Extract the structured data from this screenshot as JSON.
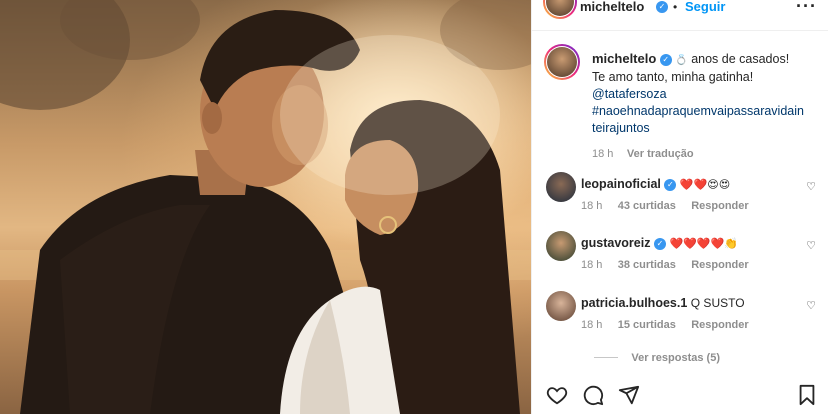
{
  "header": {
    "username": "micheltelo",
    "separator": "•",
    "follow_label": "Seguir",
    "more_icon": "more-horizontal-icon"
  },
  "caption": {
    "username": "micheltelo",
    "line1_text": "anos de casados!",
    "line2": "Te amo tanto, minha gatinha!",
    "mention": "@tatafersoza",
    "hashtag_line1": "#naoehnadapraquemvaipassaravidain",
    "hashtag_line2": "teirajuntos",
    "time": "18 h",
    "translate_label": "Ver tradução"
  },
  "comments": [
    {
      "username": "leopainoficial",
      "text": "❤️❤️😍😍",
      "time": "18 h",
      "likes": "43 curtidas",
      "reply_label": "Responder"
    },
    {
      "username": "gustavoreiz",
      "text": "❤️❤️❤️❤️👏",
      "time": "18 h",
      "likes": "38 curtidas",
      "reply_label": "Responder"
    },
    {
      "username": "patricia.bulhoes.1",
      "text": "Q SUSTO",
      "time": "18 h",
      "likes": "15 curtidas",
      "reply_label": "Responder"
    }
  ],
  "view_replies_label": "Ver respostas (5)",
  "actions": {
    "like_icon": "heart-icon",
    "comment_icon": "comment-icon",
    "share_icon": "share-icon",
    "save_icon": "bookmark-icon"
  },
  "colors": {
    "link": "#00376b",
    "follow": "#0095f6",
    "verified": "#3897f0",
    "heart": "#ed4956"
  }
}
